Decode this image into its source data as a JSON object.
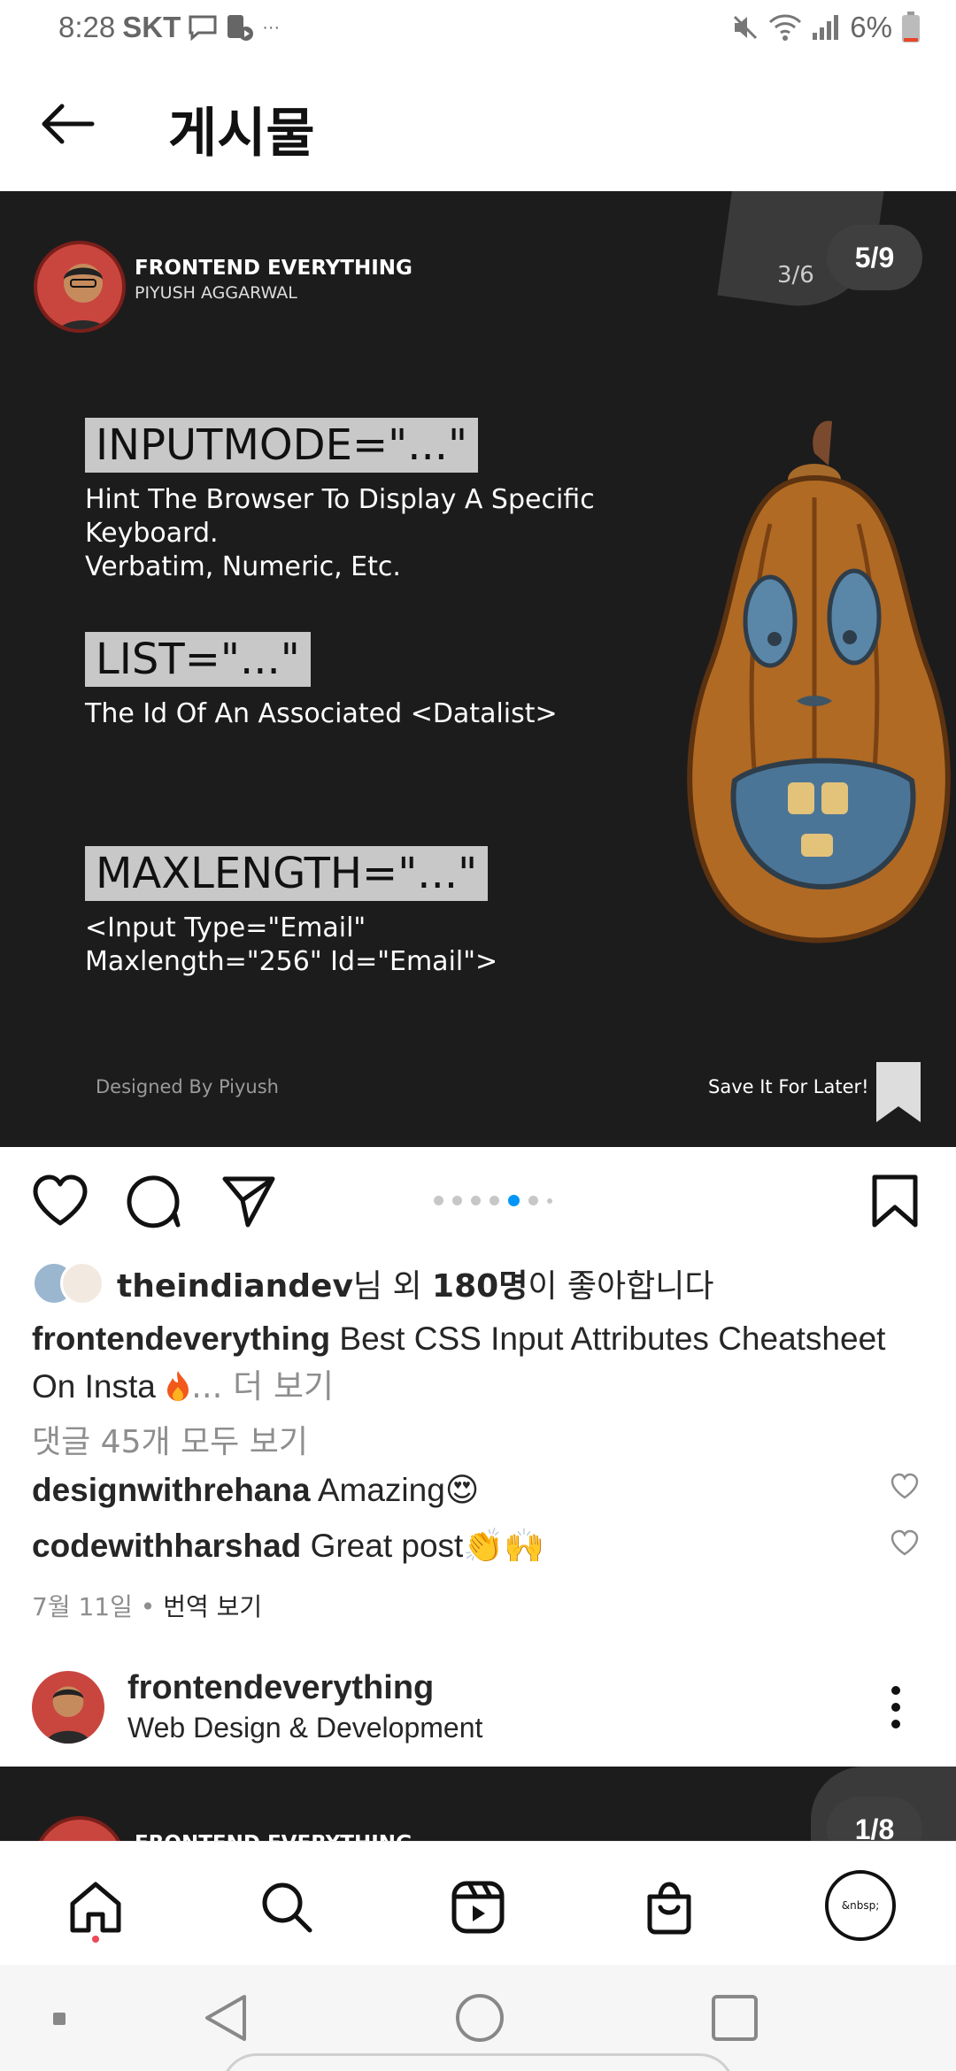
{
  "status_bar": {
    "time": "8:28",
    "carrier": "SKT",
    "extra": "···",
    "battery": "6%"
  },
  "header": {
    "title": "게시물"
  },
  "post": {
    "brand": "FRONTEND EVERYTHING",
    "author": "PIYUSH AGGARWAL",
    "inner_slide": "3/6",
    "counter": "5/9",
    "attrs": [
      {
        "label": "INPUTMODE=\"...\"",
        "desc1": "Hint The Browser To Display A Specific",
        "desc2": "Keyboard.",
        "desc3": "Verbatim, Numeric, Etc."
      },
      {
        "label": "LIST=\"...\"",
        "desc1": "The Id Of An Associated <Datalist>"
      },
      {
        "label": "MAXLENGTH=\"...\"",
        "desc1": "<Input Type=\"Email\"",
        "desc2": "Maxlength=\"256\" Id=\"Email\">"
      }
    ],
    "designed_by": "Designed By Piyush",
    "save_later": "Save It For Later!"
  },
  "likes": {
    "user": "theindiandev",
    "middle": "님 외 ",
    "count": "180명",
    "suffix": "이 좋아합니다"
  },
  "caption": {
    "username": "frontendeverything",
    "text": "Best CSS Input Attributes Cheatsheet On Insta",
    "more": "... 더 보기"
  },
  "view_comments": "댓글 45개 모두 보기",
  "comments": [
    {
      "user": "designwithrehana",
      "text": "Amazing😍"
    },
    {
      "user": "codewithharshad",
      "text": "Great post👏🙌"
    }
  ],
  "date": "7월 11일",
  "date_sep": " • ",
  "translate": "번역 보기",
  "next_post": {
    "name": "frontendeverything",
    "subtitle": "Web Design & Development",
    "brand": "FRONTEND EVERYTHING",
    "counter": "1/8"
  },
  "profile_label": "&nbsp;",
  "colors": {
    "accent": "#0095f6",
    "post_bg": "#1c1c1c",
    "notification_dot": "#ed4956"
  }
}
